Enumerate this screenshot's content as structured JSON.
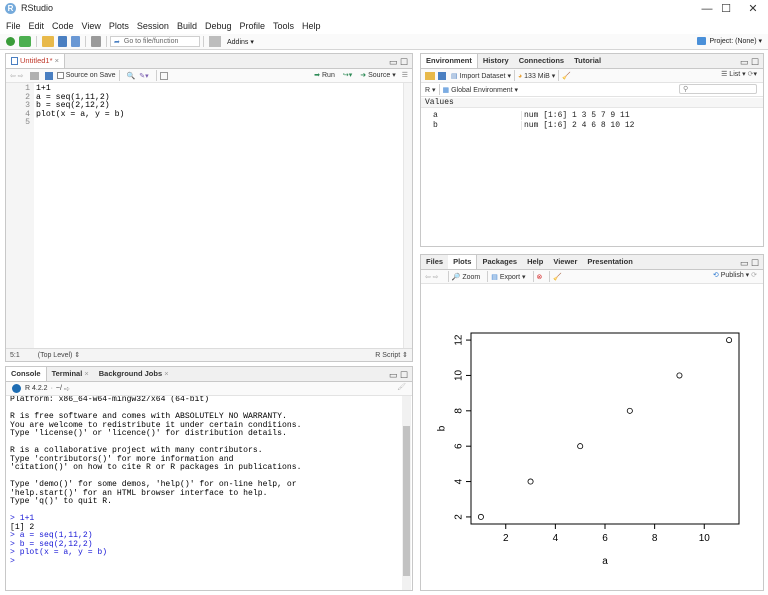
{
  "window": {
    "title": "RStudio",
    "minimize": "—",
    "maximize": "☐",
    "close": "✕"
  },
  "menu": [
    "File",
    "Edit",
    "Code",
    "View",
    "Plots",
    "Session",
    "Build",
    "Debug",
    "Profile",
    "Tools",
    "Help"
  ],
  "toolbar": {
    "goto_placeholder": "Go to file/function",
    "addins": "Addins",
    "project": "Project: (None)"
  },
  "editor": {
    "tab_label": "Untitled1*",
    "source_on_save": "Source on Save",
    "run": "Run",
    "source": "Source",
    "line_numbers": [
      "1",
      "2",
      "3",
      "4",
      "5"
    ],
    "lines": [
      "1+1",
      "a = seq(1,11,2)",
      "b = seq(2,12,2)",
      "plot(x = a, y = b)",
      ""
    ],
    "status_pos": "5:1",
    "status_level": "(Top Level)",
    "status_lang": "R Script"
  },
  "console": {
    "tabs": [
      "Console",
      "Terminal",
      "Background Jobs"
    ],
    "r_version": "R 4.2.2",
    "path": "~/",
    "output": [
      {
        "t": "Platform: x86_64-w64-mingw32/x64 (64-bit)",
        "c": "out"
      },
      {
        "t": "",
        "c": "out"
      },
      {
        "t": "R is free software and comes with ABSOLUTELY NO WARRANTY.",
        "c": "out"
      },
      {
        "t": "You are welcome to redistribute it under certain conditions.",
        "c": "out"
      },
      {
        "t": "Type 'license()' or 'licence()' for distribution details.",
        "c": "out"
      },
      {
        "t": "",
        "c": "out"
      },
      {
        "t": "R is a collaborative project with many contributors.",
        "c": "out"
      },
      {
        "t": "Type 'contributors()' for more information and",
        "c": "out"
      },
      {
        "t": "'citation()' on how to cite R or R packages in publications.",
        "c": "out"
      },
      {
        "t": "",
        "c": "out"
      },
      {
        "t": "Type 'demo()' for some demos, 'help()' for on-line help, or",
        "c": "out"
      },
      {
        "t": "'help.start()' for an HTML browser interface to help.",
        "c": "out"
      },
      {
        "t": "Type 'q()' to quit R.",
        "c": "out"
      },
      {
        "t": "",
        "c": "out"
      },
      {
        "t": "> 1+1",
        "c": "in"
      },
      {
        "t": "[1] 2",
        "c": "out"
      },
      {
        "t": "> a = seq(1,11,2)",
        "c": "in"
      },
      {
        "t": "> b = seq(2,12,2)",
        "c": "in"
      },
      {
        "t": "> plot(x = a, y = b)",
        "c": "in"
      },
      {
        "t": "> ",
        "c": "in"
      }
    ]
  },
  "environment": {
    "tabs": [
      "Environment",
      "History",
      "Connections",
      "Tutorial"
    ],
    "import_dataset": "Import Dataset",
    "memory": "133 MiB",
    "list_view": "List",
    "lang": "R",
    "scope": "Global Environment",
    "section": "Values",
    "vars": [
      {
        "name": "a",
        "value": "num [1:6] 1 3 5 7 9 11"
      },
      {
        "name": "b",
        "value": "num [1:6] 2 4 6 8 10 12"
      }
    ]
  },
  "files": {
    "tabs": [
      "Files",
      "Plots",
      "Packages",
      "Help",
      "Viewer",
      "Presentation"
    ],
    "zoom": "Zoom",
    "export": "Export",
    "publish": "Publish"
  },
  "chart_data": {
    "type": "scatter",
    "x": [
      1,
      3,
      5,
      7,
      9,
      11
    ],
    "y": [
      2,
      4,
      6,
      8,
      10,
      12
    ],
    "xlabel": "a",
    "ylabel": "b",
    "xlim": [
      0.6,
      11.4
    ],
    "ylim": [
      1.6,
      12.4
    ],
    "xticks": [
      2,
      4,
      6,
      8,
      10
    ],
    "yticks": [
      2,
      4,
      6,
      8,
      10,
      12
    ],
    "grid": false,
    "marker": "open-circle"
  }
}
